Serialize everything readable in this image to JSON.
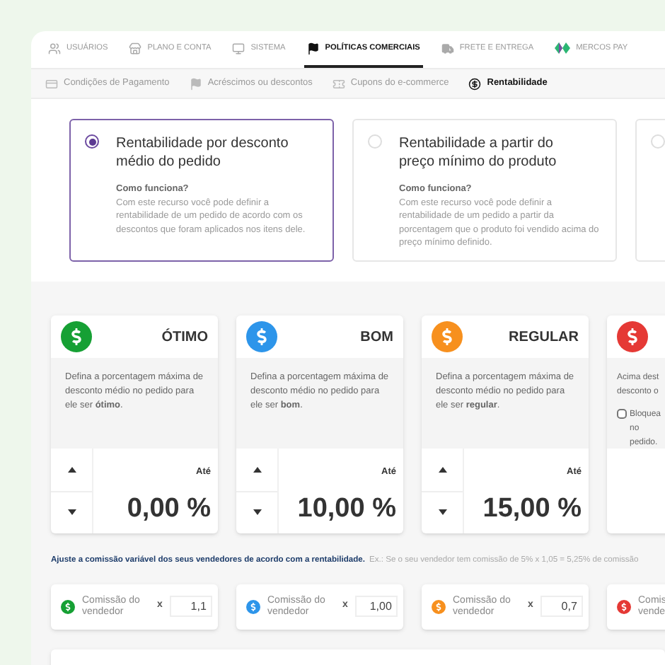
{
  "nav": [
    {
      "label": "USUÁRIOS",
      "selected": false
    },
    {
      "label": "PLANO E CONTA",
      "selected": false
    },
    {
      "label": "SISTEMA",
      "selected": false
    },
    {
      "label": "POLÍTICAS COMERCIAIS",
      "selected": true
    },
    {
      "label": "FRETE E ENTREGA",
      "selected": false
    },
    {
      "label": "MERCOS PAY",
      "selected": false
    }
  ],
  "subtabs": [
    {
      "label": "Condições de Pagamento",
      "selected": false
    },
    {
      "label": "Acréscimos ou descontos",
      "selected": false
    },
    {
      "label": "Cupons do e-commerce",
      "selected": false
    },
    {
      "label": "Rentabilidade",
      "selected": true
    }
  ],
  "options": [
    {
      "selected": true,
      "title": "Rentabilidade por desconto médio do pedido",
      "subtitle": "Como funciona?",
      "description": "Com este recurso você pode definir a rentabilidade de um pedido de acordo com os descontos que foram aplicados nos itens dele."
    },
    {
      "selected": false,
      "title": "Rentabilidade a partir do preço mínimo do produto",
      "subtitle": "Como funciona?",
      "description": "Com este recurso você pode definir a rentabilidade de um pedido a partir da porcentagem que o produto foi vendido acima do preço mínimo definido."
    },
    {
      "selected": false
    }
  ],
  "levels": [
    {
      "kind": "range",
      "color": "#16a034",
      "title": "ÓTIMO",
      "description": "Defina a porcentagem máxima de desconto médio no pedido para ele ser **ótimo**.",
      "label": "Até",
      "value": "0,00 %"
    },
    {
      "kind": "range",
      "color": "#2d95ea",
      "title": "BOM",
      "description": "Defina a porcentagem máxima de desconto médio no pedido para ele ser **bom**.",
      "label": "Até",
      "value": "10,00 %"
    },
    {
      "kind": "range",
      "color": "#f7901e",
      "title": "REGULAR",
      "description": "Defina a porcentagem máxima de desconto médio no pedido para ele ser **regular**.",
      "label": "Até",
      "value": "15,00 %"
    },
    {
      "kind": "block",
      "color": "#e53935",
      "description": "Acima dest desconto o",
      "checkbox": {
        "label": "Bloquea no pedido.",
        "checked": false
      }
    }
  ],
  "commission_note": {
    "text": "Ajuste a comissão variável dos seus vendedores de acordo com a rentabilidade.",
    "example": "Ex.: Se o seu vendedor tem comissão de 5% x 1,05 = 5,25% de comissão"
  },
  "commissions": [
    {
      "color": "#16a034",
      "label": "Comissão do vendedor",
      "operator": "x",
      "value": "1,1"
    },
    {
      "color": "#2d95ea",
      "label": "Comissão do vendedor",
      "operator": "x",
      "value": "1,00"
    },
    {
      "color": "#f7901e",
      "label": "Comissão do vendedor",
      "operator": "x",
      "value": "0,7"
    },
    {
      "color": "#e53935",
      "label": "Comis vende"
    }
  ]
}
